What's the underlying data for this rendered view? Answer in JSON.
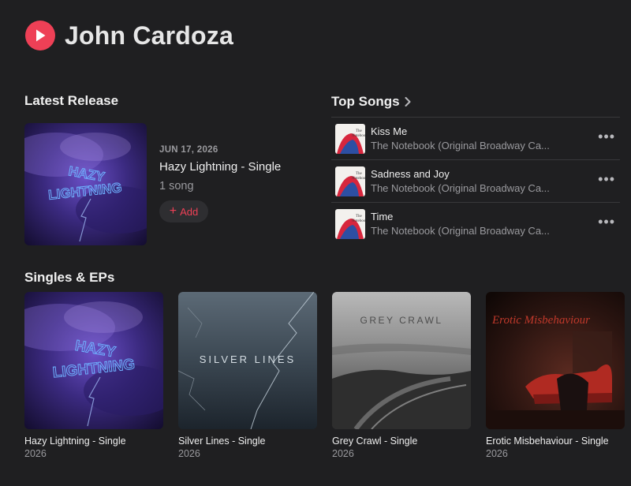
{
  "artist": {
    "name": "John Cardoza"
  },
  "latest_release": {
    "section_title": "Latest Release",
    "date": "JUN 17, 2026",
    "title": "Hazy Lightning - Single",
    "count": "1 song",
    "add_label": "Add"
  },
  "top_songs": {
    "section_title": "Top Songs",
    "items": [
      {
        "title": "Kiss Me",
        "subtitle": "The Notebook (Original Broadway Ca..."
      },
      {
        "title": "Sadness and Joy",
        "subtitle": "The Notebook (Original Broadway Ca..."
      },
      {
        "title": "Time",
        "subtitle": "The Notebook (Original Broadway Ca..."
      }
    ]
  },
  "singles": {
    "section_title": "Singles & EPs",
    "items": [
      {
        "title": "Hazy Lightning - Single",
        "year": "2026",
        "art_text": "HAZY LIGHTNING"
      },
      {
        "title": "Silver Lines - Single",
        "year": "2026",
        "art_text": "SILVER LINES"
      },
      {
        "title": "Grey Crawl - Single",
        "year": "2026",
        "art_text": "GREY CRAWL"
      },
      {
        "title": "Erotic Misbehaviour - Single",
        "year": "2026",
        "art_text": "Erotic Misbehaviour"
      }
    ]
  },
  "colors": {
    "accent": "#ee4056",
    "background": "#1f1f21",
    "secondary_text": "#9a9a9e"
  },
  "icons": {
    "play": "play-icon",
    "chevron": "chevron-right-icon",
    "more": "more-icon",
    "plus": "plus-icon"
  }
}
